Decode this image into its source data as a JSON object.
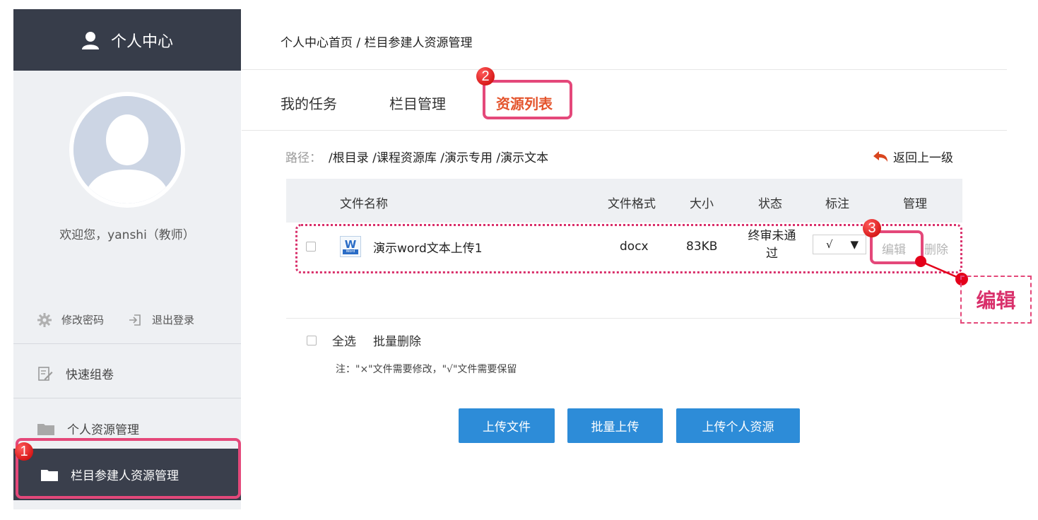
{
  "sidebar": {
    "title": "个人中心",
    "welcome": "欢迎您，yanshi（教师）",
    "change_password": "修改密码",
    "logout": "退出登录",
    "nav": [
      {
        "label": "快速组卷"
      },
      {
        "label": "个人资源管理"
      },
      {
        "label": "栏目参建人资源管理"
      }
    ]
  },
  "breadcrumb": "个人中心首页 / 栏目参建人资源管理",
  "tabs": [
    {
      "label": "我的任务"
    },
    {
      "label": "栏目管理"
    },
    {
      "label": "资源列表"
    }
  ],
  "path": {
    "label": "路径：",
    "value": "/根目录 /课程资源库 /演示专用 /演示文本"
  },
  "back_label": "返回上一级",
  "table": {
    "headers": [
      "文件名称",
      "文件格式",
      "大小",
      "状态",
      "标注",
      "管理"
    ],
    "rows": [
      {
        "name": "演示word文本上传1",
        "icon_text": "W",
        "icon_sub": "Word",
        "format": "docx",
        "size": "83KB",
        "status_line1": "终审未通",
        "status_line2": "过",
        "mark": "√",
        "edit": "编辑",
        "delete": "删除"
      }
    ]
  },
  "bulk": {
    "select_all": "全选",
    "batch_delete": "批量删除"
  },
  "note": "注：\"×\"文件需要修改，\"√\"文件需要保留",
  "buttons": {
    "upload_file": "上传文件",
    "batch_upload": "批量上传",
    "upload_personal": "上传个人资源"
  },
  "annotations": {
    "step1": "1",
    "step2": "2",
    "step3": "3",
    "callout": "编辑"
  },
  "colors": {
    "sidebar_header": "#373d4a",
    "accent_tab": "#e4542c",
    "button_blue": "#2d8cd8",
    "annotation_pink": "#e4487a"
  }
}
